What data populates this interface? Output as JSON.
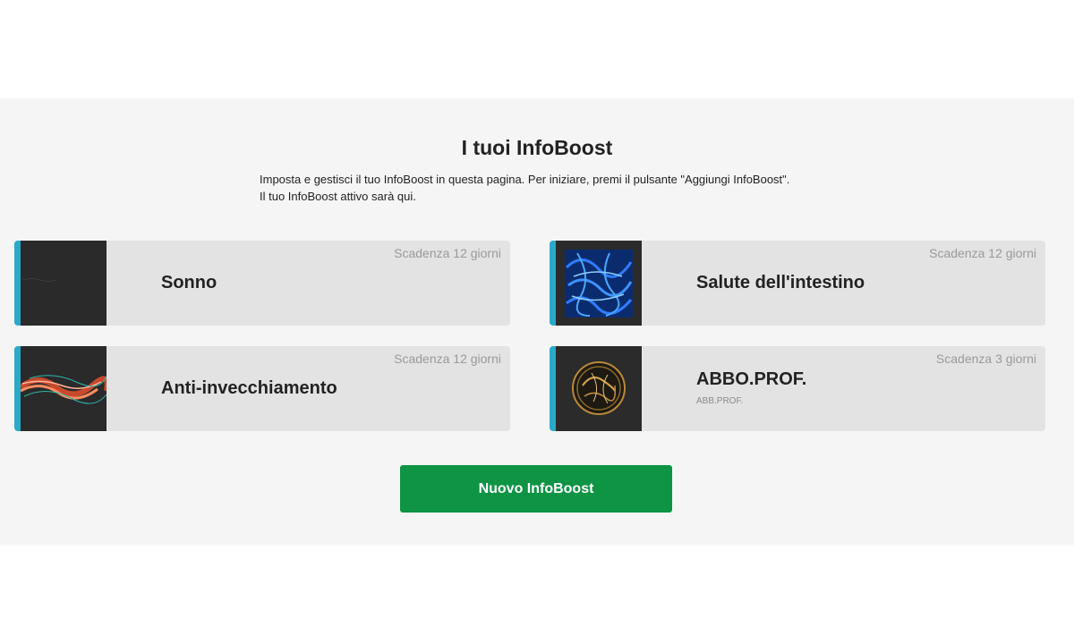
{
  "page": {
    "title": "I tuoi InfoBoost",
    "description_line1": "Imposta e gestisci il tuo InfoBoost in questa pagina. Per iniziare, premi il pulsante \"Aggiungi InfoBoost\".",
    "description_line2": "Il tuo InfoBoost attivo sarà qui."
  },
  "colors": {
    "accent": "#2aa9c9",
    "button": "#0e9444",
    "card_background": "#e3e3e3",
    "section_background": "#f5f5f5"
  },
  "cards": [
    {
      "name": "Sonno",
      "expiry": "Scadenza 12 giorni",
      "subtitle": "",
      "icon": "sleep-thumbnail"
    },
    {
      "name": "Salute dell'intestino",
      "expiry": "Scadenza 12 giorni",
      "subtitle": "",
      "icon": "blue-energy-thumbnail"
    },
    {
      "name": "Anti-invecchiamento",
      "expiry": "Scadenza 12 giorni",
      "subtitle": "",
      "icon": "red-wave-thumbnail"
    },
    {
      "name": "ABBO.PROF.",
      "expiry": "Scadenza 3 giorni",
      "subtitle": "ABB.PROF.",
      "icon": "gold-sphere-thumbnail"
    }
  ],
  "actions": {
    "new_button_label": "Nuovo InfoBoost"
  }
}
